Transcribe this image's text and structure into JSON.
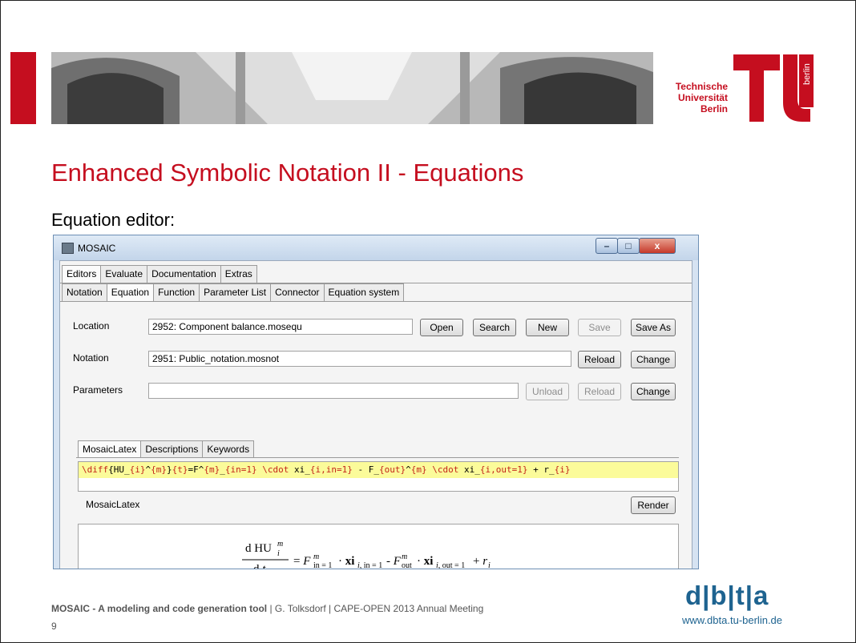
{
  "slide": {
    "title": "Enhanced Symbolic Notation II - Equations",
    "subtitle": "Equation editor:",
    "footer_bold": "MOSAIC -  A modeling and code generation tool",
    "footer_rest": " | G. Tolksdorf | CAPE-OPEN 2013 Annual Meeting",
    "page_number": "9",
    "dbta_logo": "d|b|t|a",
    "dbta_url": "www.dbta.tu-berlin.de",
    "tu_logo": {
      "line1": "Technische",
      "line2": "Universität",
      "line3": "Berlin",
      "vertical": "berlin",
      "colors": {
        "accent": "#c50e1f",
        "dbta_blue": "#1e6390"
      }
    }
  },
  "window": {
    "title": "MOSAIC",
    "controls": {
      "minimize": "–",
      "maximize": "□",
      "close": "x"
    }
  },
  "main_tabs": [
    "Editors",
    "Evaluate",
    "Documentation",
    "Extras"
  ],
  "editor_tabs": [
    "Notation",
    "Equation",
    "Function",
    "Parameter List",
    "Connector",
    "Equation system"
  ],
  "active_main_tab": "Editors",
  "active_editor_tab": "Equation",
  "form": {
    "location": {
      "label": "Location",
      "value": "2952: Component balance.mosequ"
    },
    "notation": {
      "label": "Notation",
      "value": "2951: Public_notation.mosnot"
    },
    "parameters": {
      "label": "Parameters",
      "value": ""
    }
  },
  "buttons": {
    "open": "Open",
    "search": "Search",
    "new": "New",
    "save": "Save",
    "save_as": "Save As",
    "reload": "Reload",
    "change": "Change",
    "unload": "Unload",
    "render": "Render"
  },
  "editor_subtabs": [
    "MosaicLatex",
    "Descriptions",
    "Keywords"
  ],
  "latex_source": "\\diff{HU_{i}^{m}}{t}=F^{m}_{in=1} \\cdot xi_{i,in=1}  - F_{out}^{m} \\cdot xi_{i,out=1} + r_{i}",
  "latex_label": "MosaicLatex",
  "rendered_equation": {
    "numerator": "d HU",
    "numerator_sup": "m",
    "numerator_sub": "i",
    "denominator": "d t",
    "rhs": "= F^m_in=1 · xi_i,in=1 - F^m_out · xi_i,out=1 + r_i"
  }
}
